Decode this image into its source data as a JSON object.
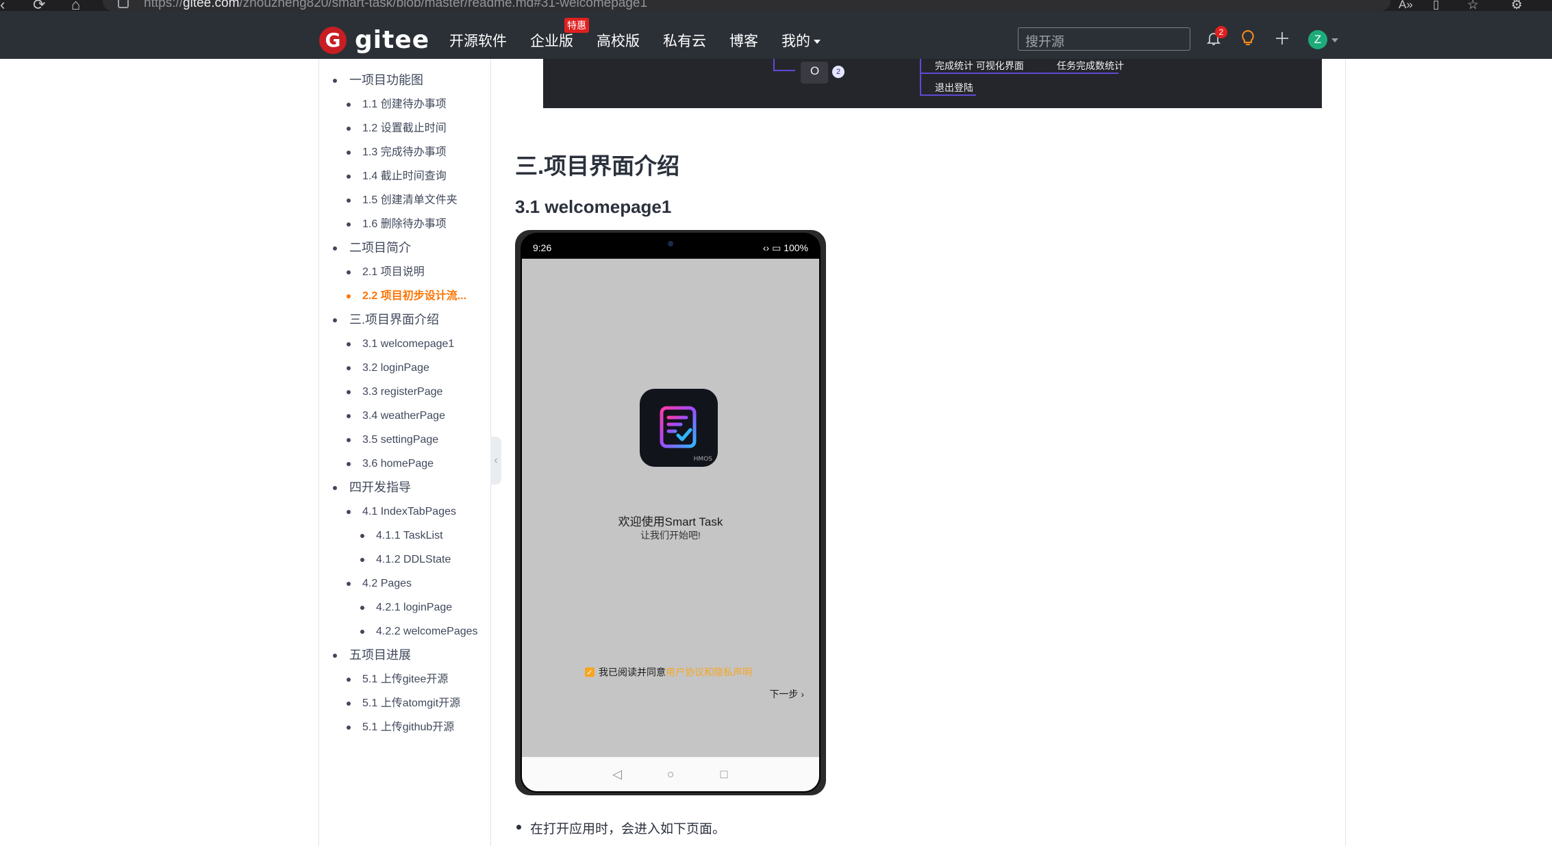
{
  "browser": {
    "url_prefix": "https://",
    "url_host": "gitee.com",
    "url_path": "/zhouzheng820/smart-task/blob/master/readme.md#31-welcomepage1"
  },
  "header": {
    "logo_text": "gitee",
    "nav": [
      {
        "label": "开源软件"
      },
      {
        "label": "企业版",
        "badge": "特惠"
      },
      {
        "label": "高校版"
      },
      {
        "label": "私有云"
      },
      {
        "label": "博客"
      },
      {
        "label": "我的"
      }
    ],
    "search_placeholder": "搜开源",
    "notification_count": "2",
    "avatar_letter": "Z"
  },
  "toc": {
    "items": [
      {
        "level": 1,
        "label": "一项目功能图"
      },
      {
        "level": 2,
        "label": "1.1 创建待办事项"
      },
      {
        "level": 2,
        "label": "1.2 设置截止时间"
      },
      {
        "level": 2,
        "label": "1.3 完成待办事项"
      },
      {
        "level": 2,
        "label": "1.4 截止时间查询"
      },
      {
        "level": 2,
        "label": "1.5 创建清单文件夹"
      },
      {
        "level": 2,
        "label": "1.6 删除待办事项"
      },
      {
        "level": 1,
        "label": "二项目简介"
      },
      {
        "level": 2,
        "label": "2.1 项目说明"
      },
      {
        "level": 2,
        "label": "2.2 项目初步设计流...",
        "active": true
      },
      {
        "level": 1,
        "label": "三.项目界面介绍"
      },
      {
        "level": 2,
        "label": "3.1 welcomepage1"
      },
      {
        "level": 2,
        "label": "3.2 loginPage"
      },
      {
        "level": 2,
        "label": "3.3 registerPage"
      },
      {
        "level": 2,
        "label": "3.4 weatherPage"
      },
      {
        "level": 2,
        "label": "3.5 settingPage"
      },
      {
        "level": 2,
        "label": "3.6 homePage"
      },
      {
        "level": 1,
        "label": "四开发指导"
      },
      {
        "level": 2,
        "label": "4.1 IndexTabPages"
      },
      {
        "level": 3,
        "label": "4.1.1 TaskList"
      },
      {
        "level": 3,
        "label": "4.1.2 DDLState"
      },
      {
        "level": 2,
        "label": "4.2 Pages"
      },
      {
        "level": 3,
        "label": "4.2.1 loginPage"
      },
      {
        "level": 3,
        "label": "4.2.2 welcomePages"
      },
      {
        "level": 1,
        "label": "五项目进展"
      },
      {
        "level": 2,
        "label": "5.1 上传gitee开源"
      },
      {
        "level": 2,
        "label": "5.1 上传atomgit开源"
      },
      {
        "level": 2,
        "label": "5.1 上传github开源"
      }
    ]
  },
  "mindmap": {
    "node_o": "O",
    "node_o_count": "2",
    "node_stats": "完成统计 可视化界面",
    "node_task_stats": "任务完成数统计",
    "node_logout": "退出登陆"
  },
  "content": {
    "section_title": "三.项目界面介绍",
    "subsection_title": "3.1 welcomepage1",
    "bullet_text": "在打开应用时，会进入如下页面。"
  },
  "phone": {
    "time": "9:26",
    "battery": "100%",
    "hmos_label": "HMOS",
    "welcome_title": "欢迎使用Smart Task",
    "welcome_sub": "让我们开始吧!",
    "agree_text": "我已阅读并同意",
    "agree_link": "用户协议和隐私声明",
    "next_label": "下一步"
  },
  "colors": {
    "accent": "#fe7300",
    "header_bg": "#2b3036",
    "brand_red": "#c71d23",
    "avatar_green": "#1eab7a",
    "checkbox_orange": "#f5a623"
  }
}
